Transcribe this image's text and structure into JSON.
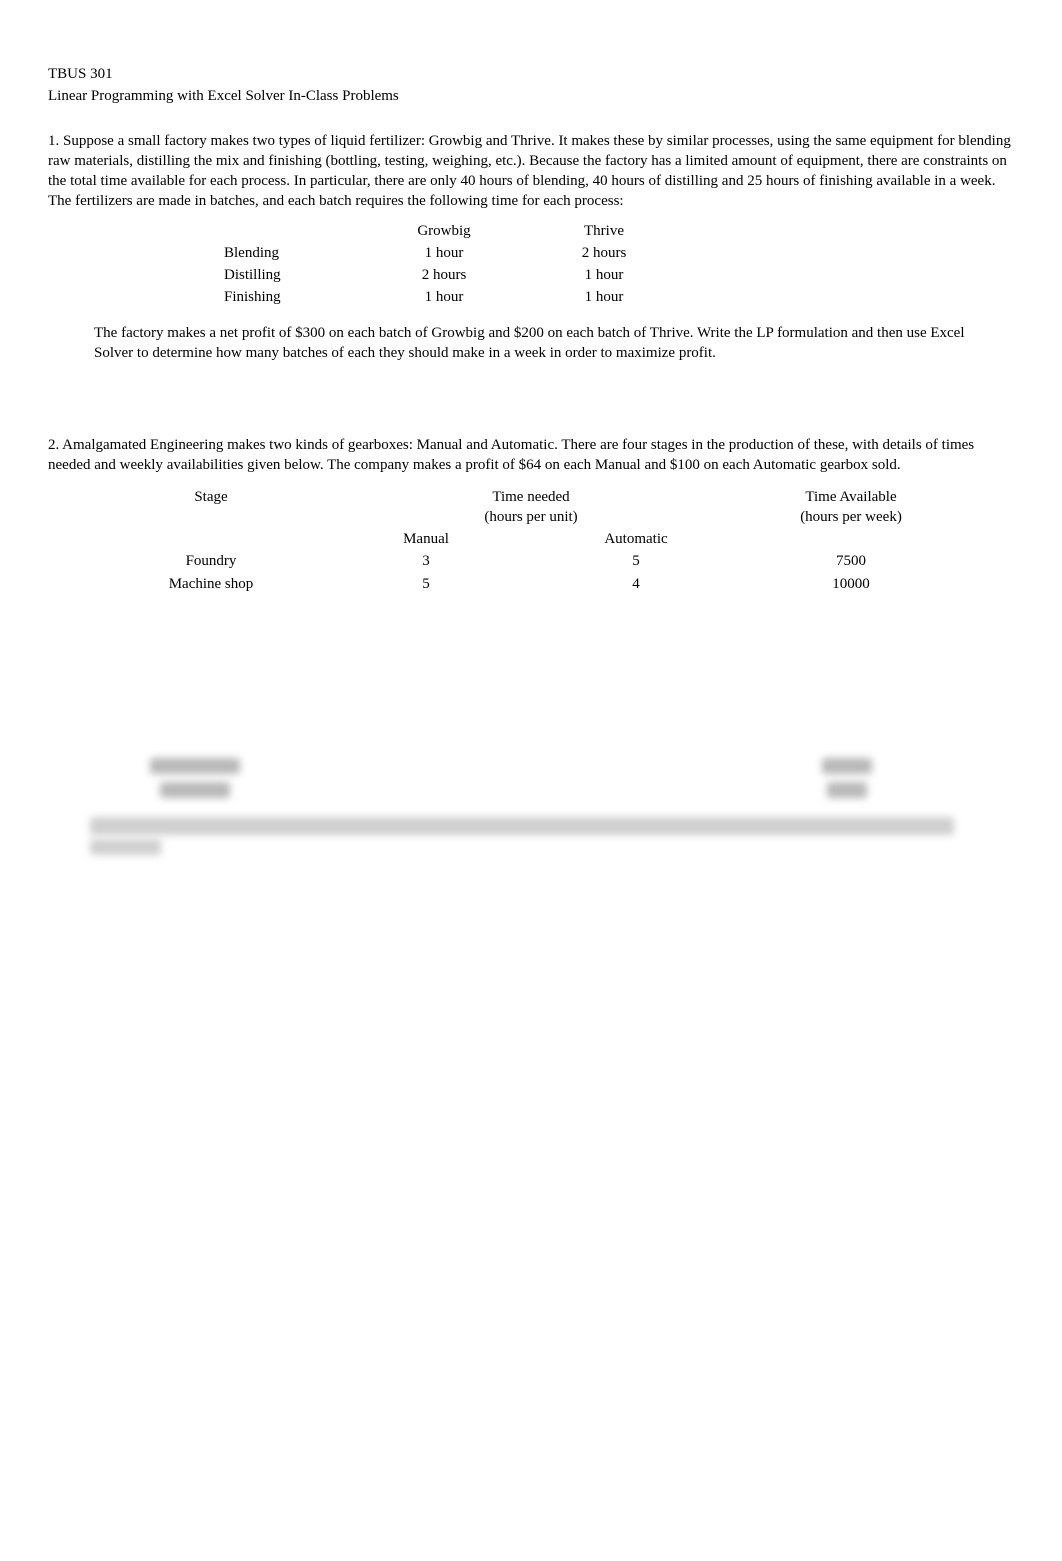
{
  "header": {
    "course": "TBUS 301",
    "subtitle": "Linear Programming with Excel Solver In-Class Problems"
  },
  "problem1": {
    "intro": "1.  Suppose a small factory makes two types of liquid fertilizer:  Growbig and Thrive. It makes these by similar processes, using the same equipment for blending raw materials, distilling the mix and finishing (bottling, testing, weighing, etc.).  Because the factory has a limited amount of equipment, there are constraints on the total time available for each process.  In particular, there are only 40 hours of blending, 40 hours of distilling and 25 hours of finishing available in a week.  The fertilizers are made in batches, and each batch requires the following time for each process:",
    "table": {
      "headers": [
        "",
        "Growbig",
        "Thrive"
      ],
      "rows": [
        [
          "Blending",
          "1 hour",
          "2 hours"
        ],
        [
          "Distilling",
          "2 hours",
          "1 hour"
        ],
        [
          "Finishing",
          "1 hour",
          "1 hour"
        ]
      ]
    },
    "followup": "The factory makes a net profit of $300 on each batch of Growbig and $200 on each batch of Thrive.   Write the LP formulation and then use Excel Solver to determine how many batches of each they should make in a week in order to maximize profit."
  },
  "problem2": {
    "intro": "2.  Amalgamated Engineering makes two kinds of gearboxes:  Manual and Automatic. There are four stages in the production of these, with details of times needed and weekly availabilities given below. The company makes a profit of $64 on each Manual and $100 on each Automatic gearbox sold.",
    "table": {
      "top_headers": {
        "stage": "Stage",
        "time_needed": "Time needed",
        "time_needed_sub": "(hours per unit)",
        "time_available": "Time Available",
        "time_available_sub": "(hours per week)"
      },
      "sub_headers": [
        "Manual",
        "Automatic"
      ],
      "rows": [
        [
          "Foundry",
          "3",
          "5",
          "7500"
        ],
        [
          "Machine shop",
          "5",
          "4",
          "10000"
        ]
      ]
    }
  }
}
